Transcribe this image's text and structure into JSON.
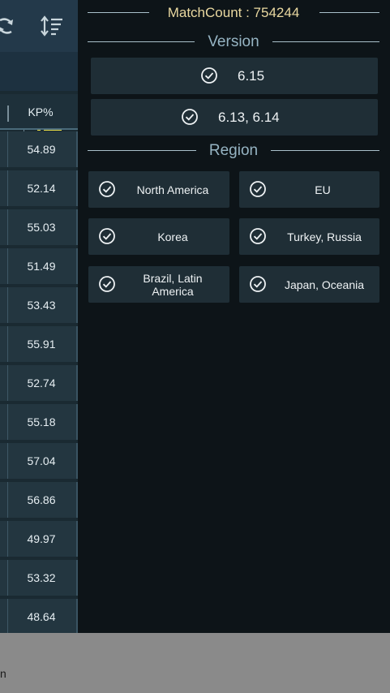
{
  "header": {
    "match_count": "MatchCount : 754244"
  },
  "version": {
    "title": "Version",
    "options": [
      {
        "label": "6.15",
        "checked": true
      },
      {
        "label": "6.13, 6.14",
        "checked": true
      }
    ]
  },
  "region": {
    "title": "Region",
    "options": [
      {
        "label": "North America",
        "checked": true
      },
      {
        "label": "EU",
        "checked": true
      },
      {
        "label": "Korea",
        "checked": true
      },
      {
        "label": "Turkey, Russia",
        "checked": true
      },
      {
        "label": "Brazil, Latin America",
        "checked": true
      },
      {
        "label": "Japan, Oceania",
        "checked": true
      }
    ]
  },
  "table": {
    "column_header": "KP%",
    "rows": [
      "54.89",
      "52.14",
      "55.03",
      "51.49",
      "53.43",
      "55.91",
      "52.74",
      "55.18",
      "57.04",
      "56.86",
      "49.97",
      "53.32",
      "48.64"
    ]
  },
  "bottom": {
    "fragment": "n"
  },
  "icons": {
    "refresh": "refresh-icon",
    "sort": "sort-icon",
    "list": "list-icon",
    "check": "check-circle-icon"
  },
  "colors": {
    "accent_yellow": "#e8de4a",
    "match_count_text": "#e9d8a0",
    "section_title": "#96b4c3",
    "card_bg": "#1f2e36"
  }
}
